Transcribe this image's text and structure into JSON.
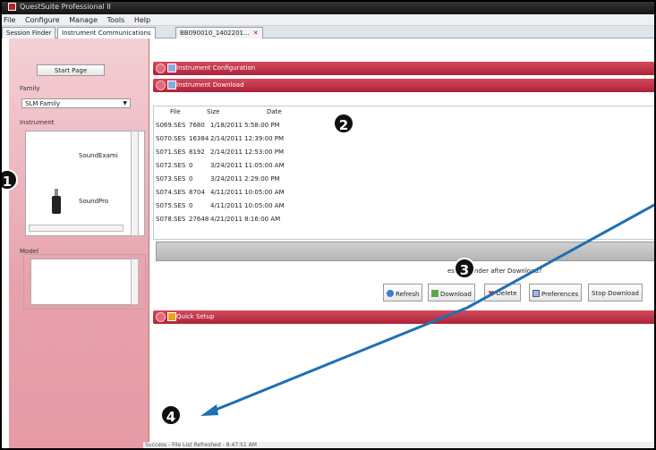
{
  "window": {
    "title": "QuestSuite Professional II"
  },
  "menu": [
    "File",
    "Configure",
    "Manage",
    "Tools",
    "Help"
  ],
  "tabs": [
    {
      "label": "Session Finder"
    },
    {
      "label": "Instrument Communications"
    },
    {
      "label": "BB090010_1402201..."
    }
  ],
  "sidebar": {
    "start_page": "Start Page",
    "family_label": "Family",
    "family_value": "SLM Family",
    "instrument_label": "Instrument",
    "instruments": [
      "SoundExami",
      "SoundPro"
    ],
    "model_label": "Model"
  },
  "sections": {
    "config": "Instrument Configuration",
    "download": "Instrument Download",
    "quick": "Quick Setup"
  },
  "files": {
    "columns": [
      "File",
      "Size",
      "Date"
    ],
    "rows": [
      [
        "S069.SES",
        "7680",
        "1/18/2011 5:58:00 PM"
      ],
      [
        "S070.SES",
        "16384",
        "2/14/2011 12:39:00 PM"
      ],
      [
        "S071.SES",
        "8192",
        "2/14/2011 12:53:00 PM"
      ],
      [
        "S072.SES",
        "0",
        "3/24/2011 11:05:00 AM"
      ],
      [
        "S073.SES",
        "0",
        "3/24/2011 2:29:00 PM"
      ],
      [
        "S074.SES",
        "8704",
        "4/11/2011 10:05:00 AM"
      ],
      [
        "S075.SES",
        "0",
        "4/11/2011 10:05:00 AM"
      ],
      [
        "S078.SES",
        "27648",
        "4/21/2011 8:16:00 AM"
      ]
    ]
  },
  "download_options": {
    "check_label": "ession Finder after Download?"
  },
  "buttons": {
    "refresh": "Refresh",
    "download": "Download",
    "delete": "Delete",
    "preferences": "Preferences",
    "stop": "Stop Download"
  },
  "status": "Success - File List Refreshed - 8:47:51 AM",
  "callouts": [
    "1",
    "2",
    "3",
    "4"
  ],
  "colors": {
    "accent": "#b8263b",
    "callout_arrow": "#1f6fb3"
  }
}
